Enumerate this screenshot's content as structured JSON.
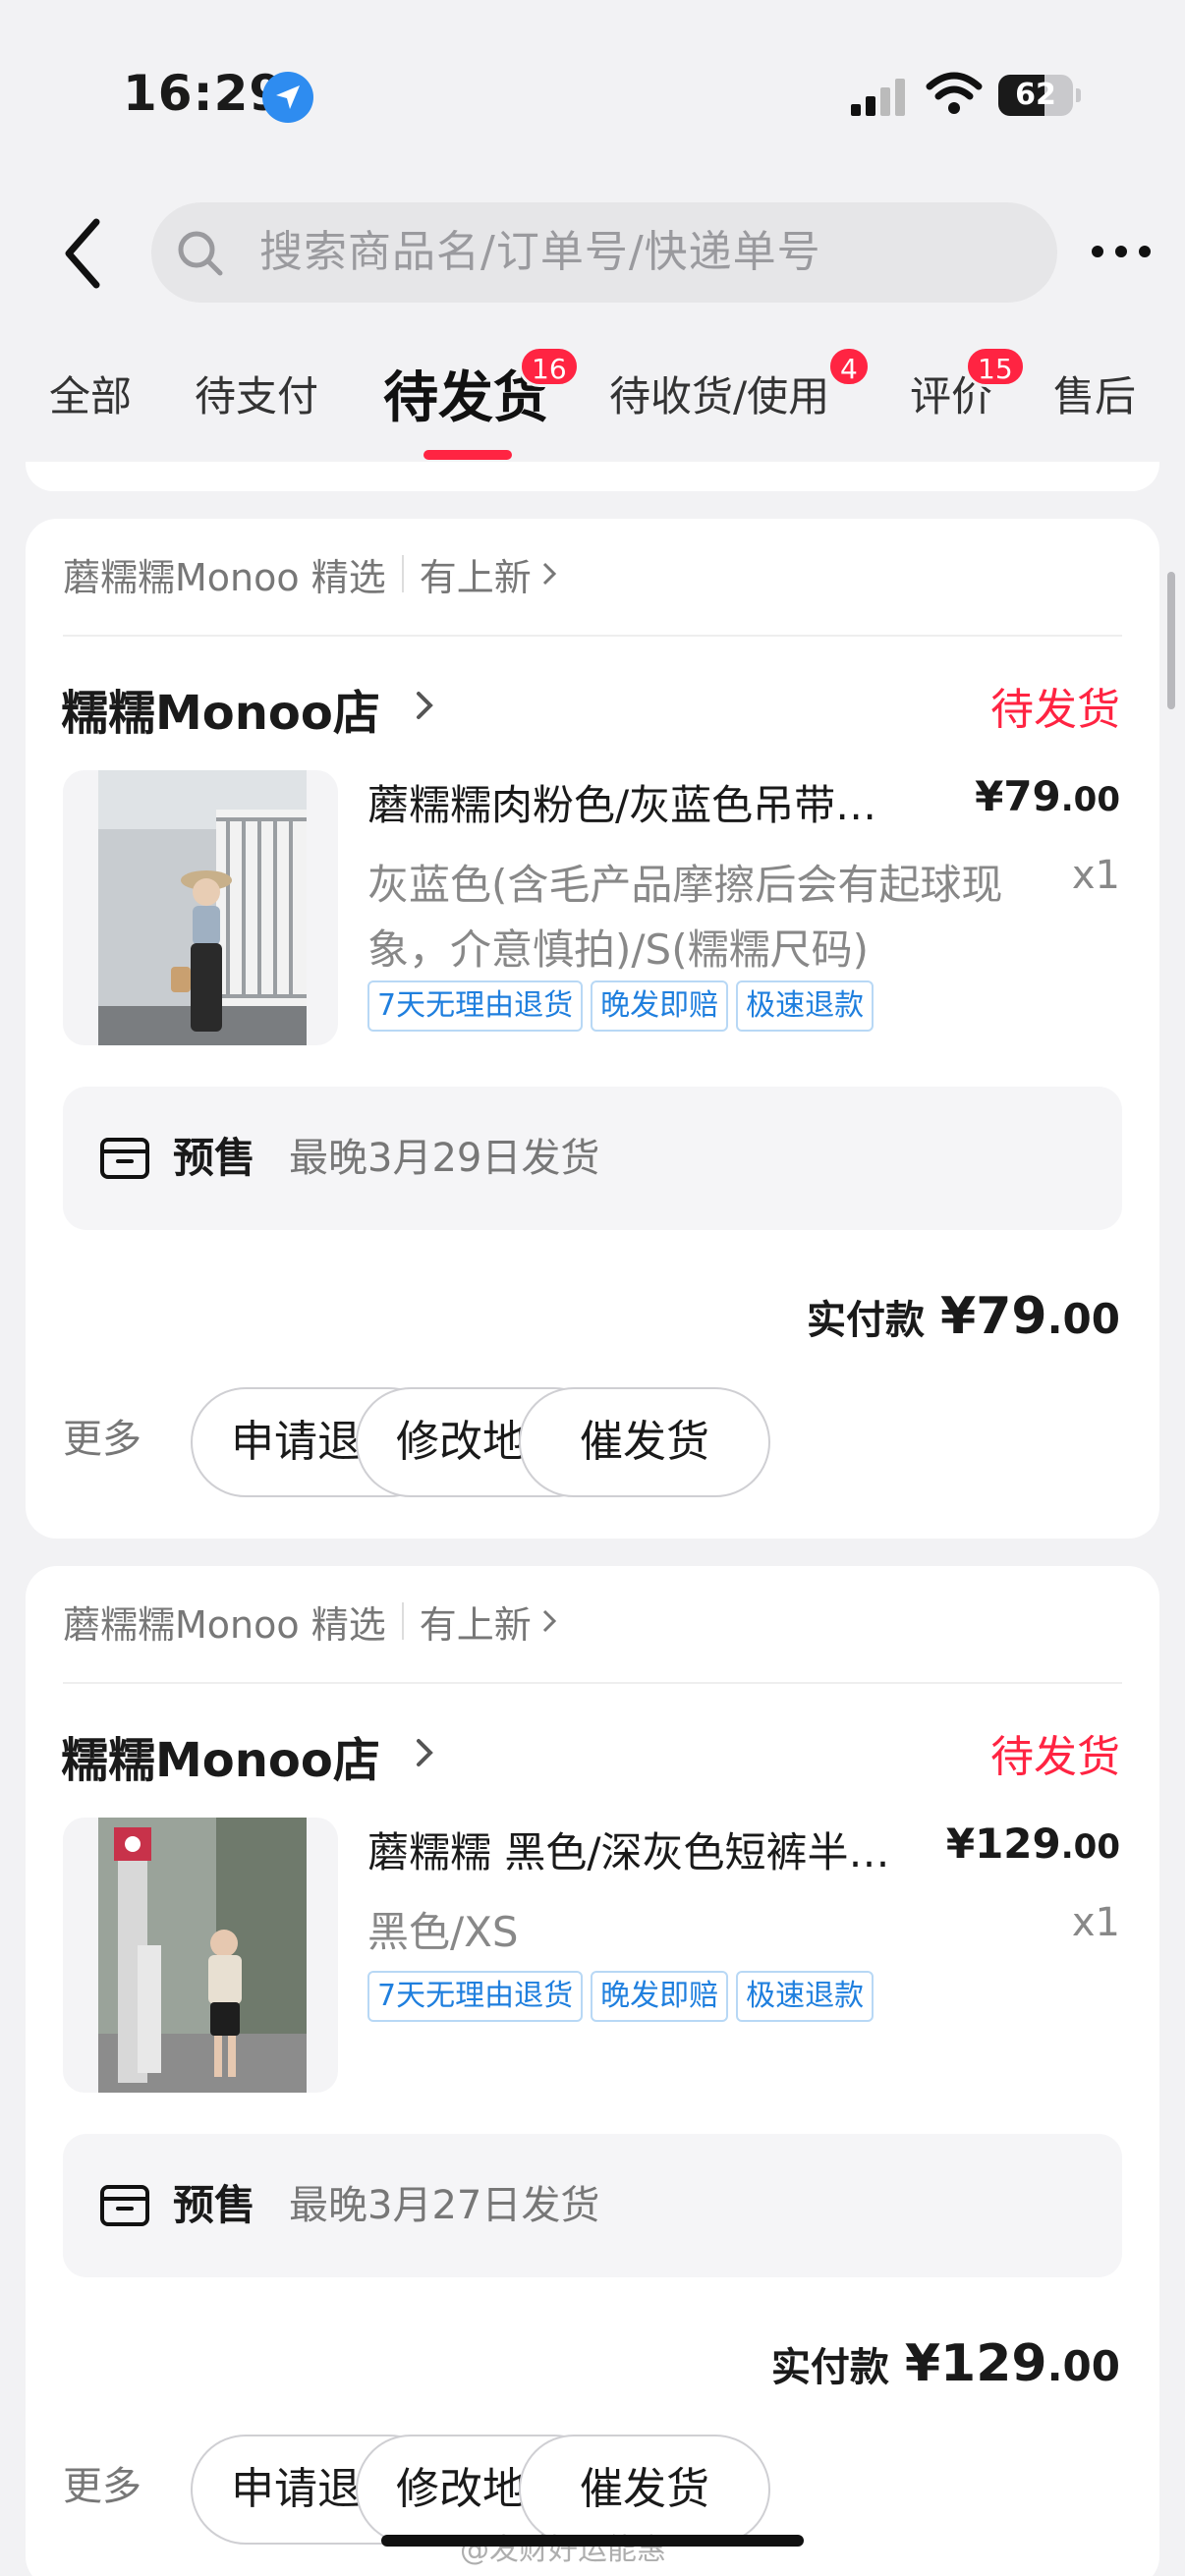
{
  "status_bar": {
    "time": "16:29",
    "battery": "62",
    "battery_level": 0.62
  },
  "header": {
    "search_placeholder": "搜索商品名/订单号/快递单号"
  },
  "tabs": [
    {
      "label": "全部",
      "badge": ""
    },
    {
      "label": "待支付",
      "badge": ""
    },
    {
      "label": "待发货",
      "badge": "16",
      "active": true
    },
    {
      "label": "待收货/使用",
      "badge": "4"
    },
    {
      "label": "评价",
      "badge": "15"
    },
    {
      "label": "售后",
      "badge": ""
    }
  ],
  "orders": [
    {
      "source": "蘑糯糯Monoo 精选",
      "source_link": "有上新",
      "shop": "糯糯Monoo店",
      "status": "待发货",
      "title": "蘑糯糯肉粉色/灰蓝色吊带背心",
      "price_main": "¥79",
      "price_dec": ".00",
      "spec": "灰蓝色(含毛产品摩擦后会有起球现象，介意慎拍)/S(糯糯尺码)",
      "qty": "x1",
      "tags": [
        "7天无理由退货",
        "晚发即赔",
        "极速退款"
      ],
      "presale_label": "预售",
      "presale_info": "最晚3月29日发货",
      "paid_label": "实付款",
      "paid_main": "¥79",
      "paid_dec": ".00",
      "more": "更多",
      "buttons": [
        "申请退款",
        "修改地址",
        "催发货"
      ]
    },
    {
      "source": "蘑糯糯Monoo 精选",
      "source_link": "有上新",
      "shop": "糯糯Monoo店",
      "status": "待发货",
      "title": "蘑糯糯 黑色/深灰色短裤半身裙",
      "price_main": "¥129",
      "price_dec": ".00",
      "spec": "黑色/XS",
      "qty": "x1",
      "tags": [
        "7天无理由退货",
        "晚发即赔",
        "极速退款"
      ],
      "presale_label": "预售",
      "presale_info": "最晚3月27日发货",
      "paid_label": "实付款",
      "paid_main": "¥129",
      "paid_dec": ".00",
      "more": "更多",
      "buttons": [
        "申请退款",
        "修改地址",
        "催发货"
      ]
    }
  ],
  "watermark": "@发财好运能惠",
  "icons": [
    "location-arrow-icon",
    "signal-icon",
    "wifi-icon",
    "battery-icon",
    "back-icon",
    "search-icon",
    "more-icon",
    "chevron-right-icon",
    "presale-box-icon"
  ],
  "colors": {
    "accent": "#ff2442",
    "tag_blue": "#1f7fde",
    "background": "#f2f2f4"
  }
}
